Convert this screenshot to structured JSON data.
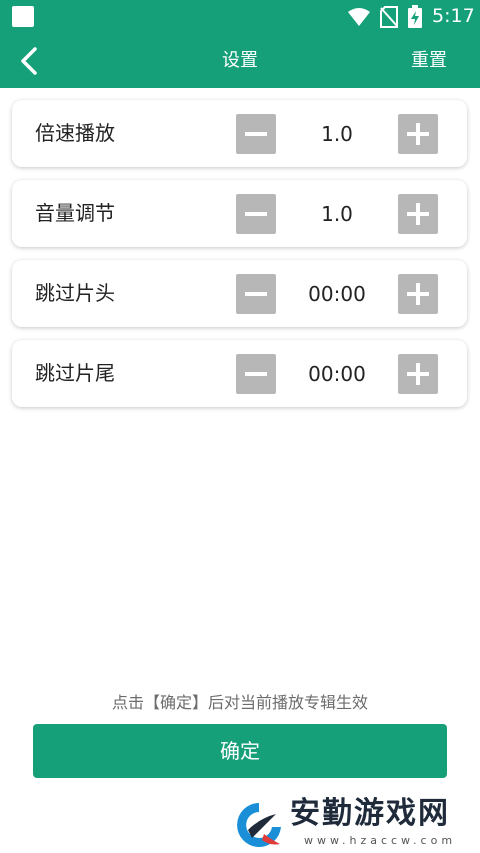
{
  "status_bar": {
    "time": "5:17"
  },
  "app_bar": {
    "title": "设置",
    "reset_label": "重置"
  },
  "settings": [
    {
      "label": "倍速播放",
      "value": "1.0"
    },
    {
      "label": "音量调节",
      "value": "1.0"
    },
    {
      "label": "跳过片头",
      "value": "00:00"
    },
    {
      "label": "跳过片尾",
      "value": "00:00"
    }
  ],
  "hint": "点击【确定】后对当前播放专辑生效",
  "confirm_label": "确定",
  "watermark": {
    "name": "安勤游戏网",
    "url": "www.hzaccw.com"
  },
  "colors": {
    "primary": "#16a07a",
    "stepper_button": "#b7b7b7"
  },
  "icons": {
    "back": "chevron-left-icon",
    "minus": "minus-icon",
    "plus": "plus-icon"
  }
}
